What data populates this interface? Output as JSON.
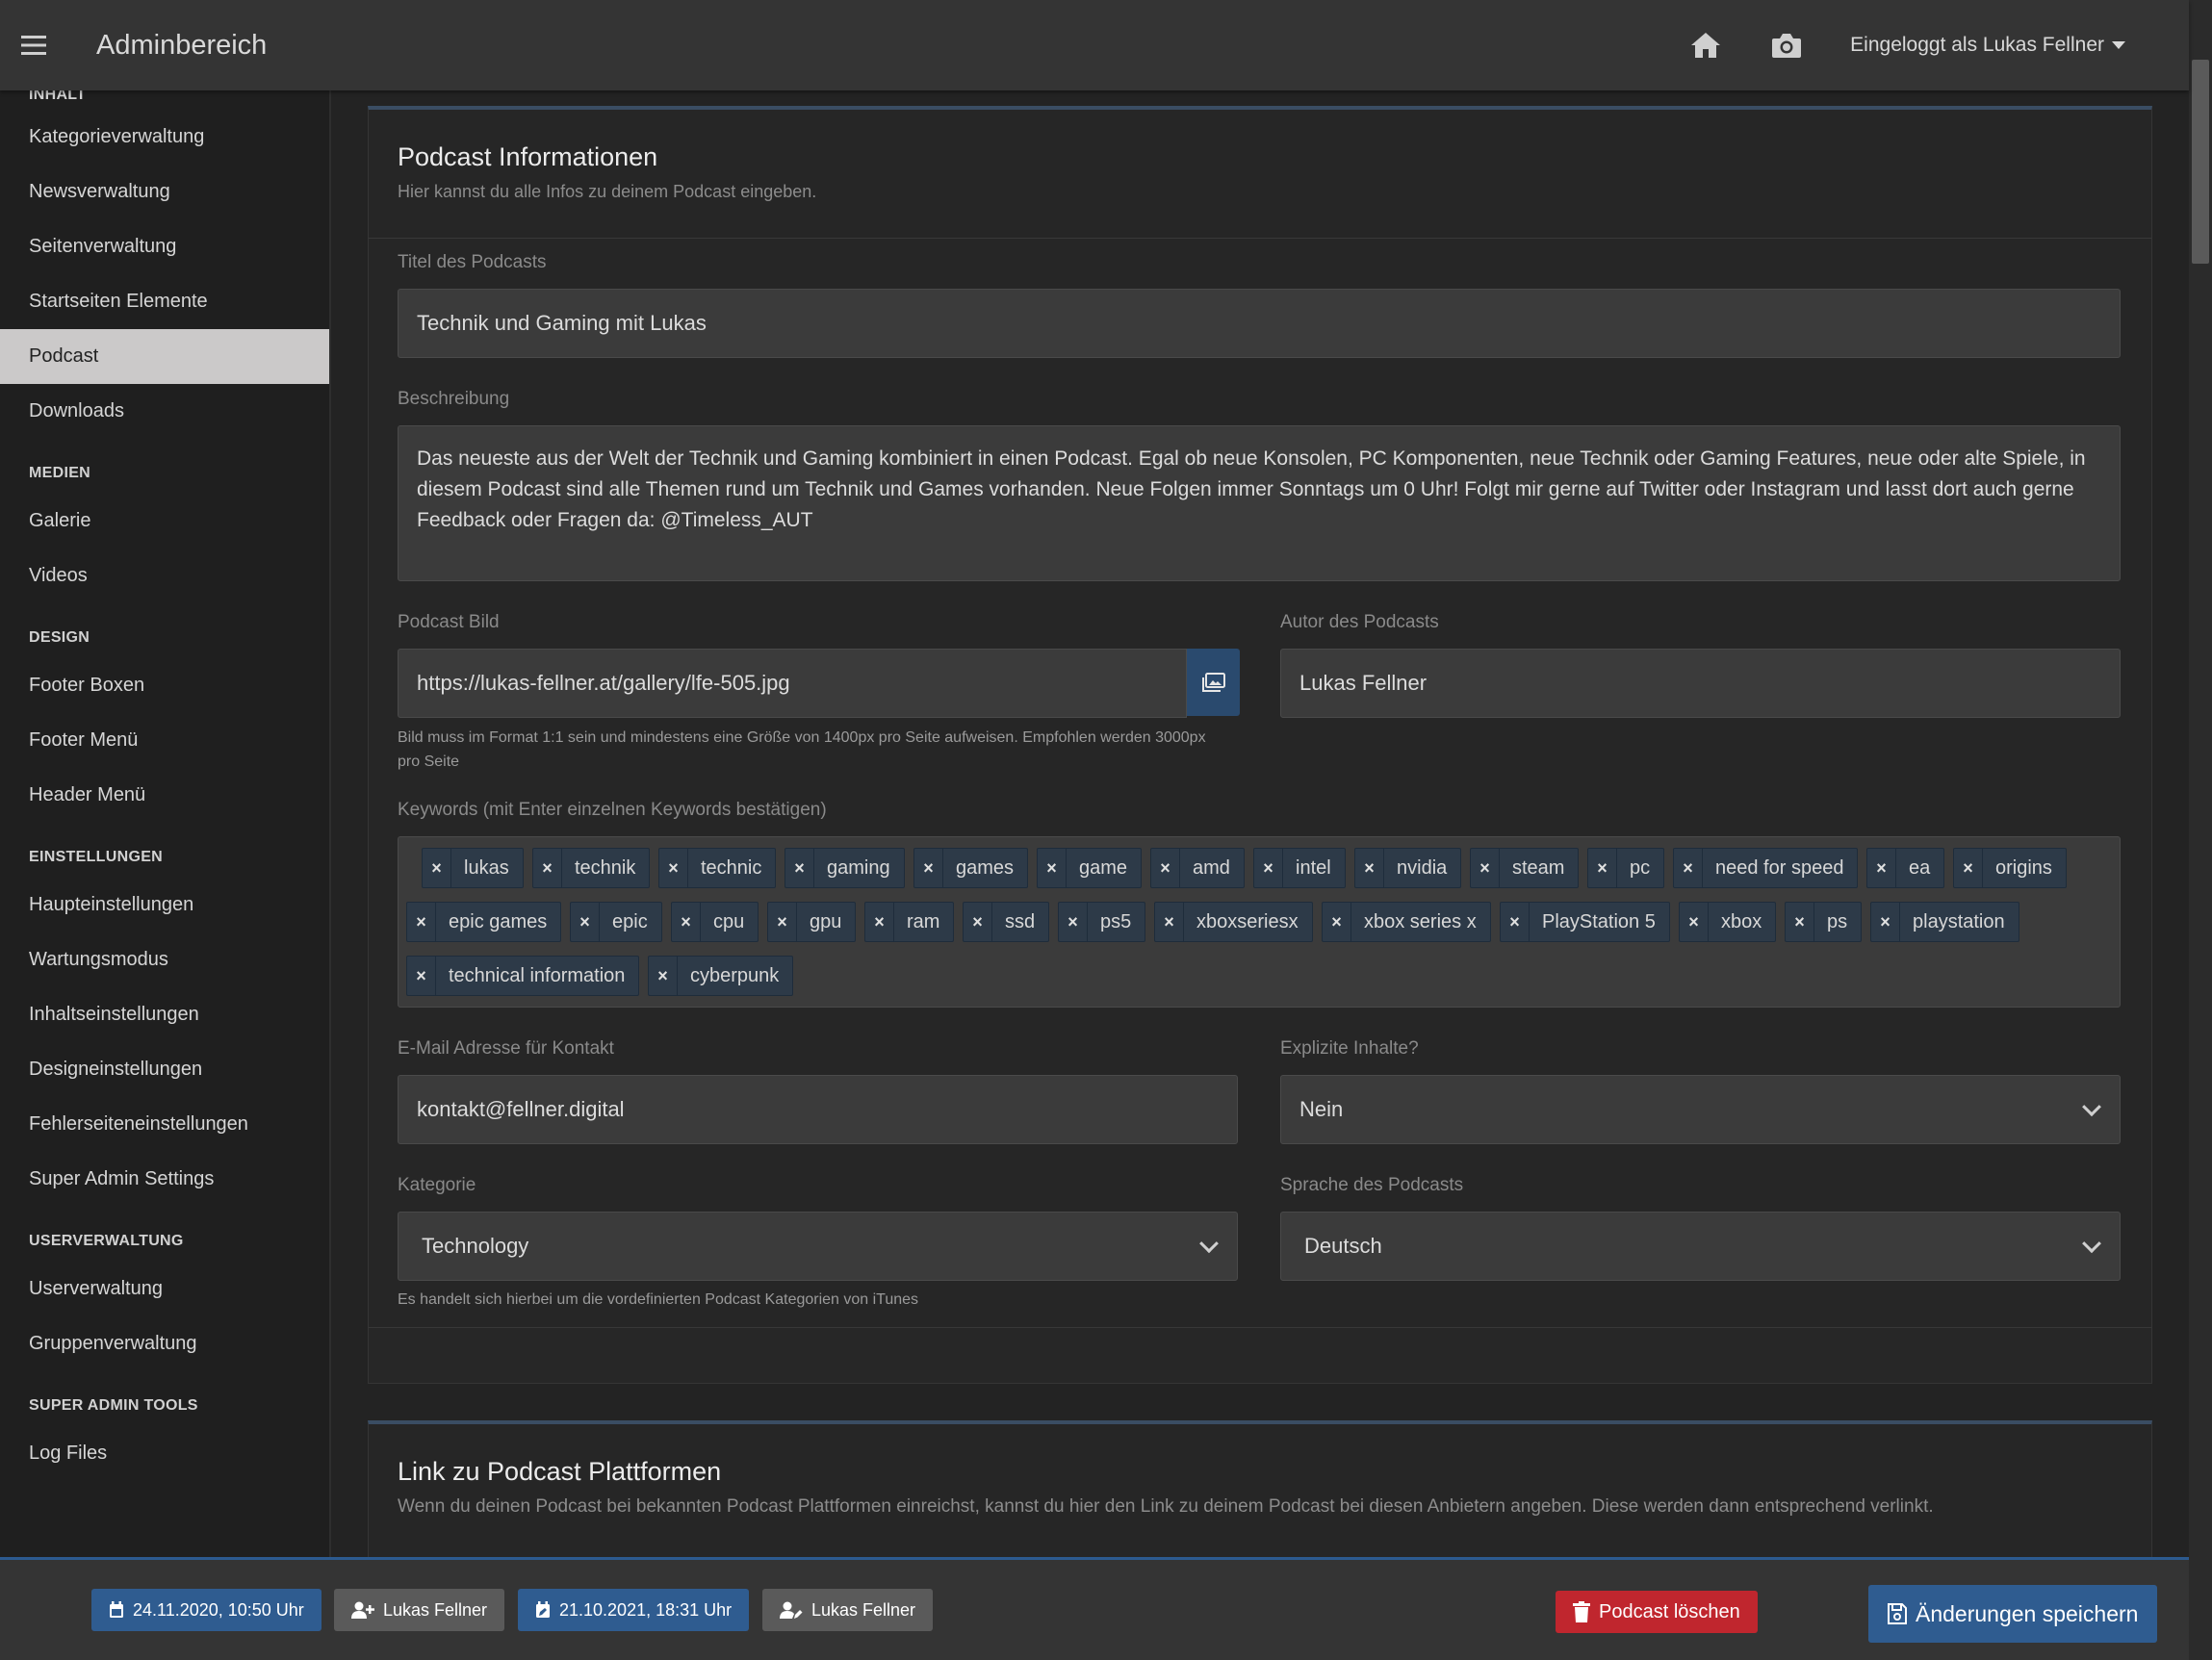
{
  "header": {
    "brand": "Adminbereich",
    "user_menu": "Eingeloggt als Lukas Fellner"
  },
  "sidebar": {
    "sections": [
      {
        "title": "INHALT",
        "items": [
          "Kategorieverwaltung",
          "Newsverwaltung",
          "Seitenverwaltung",
          "Startseiten Elemente",
          "Podcast",
          "Downloads"
        ]
      },
      {
        "title": "MEDIEN",
        "items": [
          "Galerie",
          "Videos"
        ]
      },
      {
        "title": "DESIGN",
        "items": [
          "Footer Boxen",
          "Footer Menü",
          "Header Menü"
        ]
      },
      {
        "title": "EINSTELLUNGEN",
        "items": [
          "Haupteinstellungen",
          "Wartungsmodus",
          "Inhaltseinstellungen",
          "Designeinstellungen",
          "Fehlerseiteneinstellungen",
          "Super Admin Settings"
        ]
      },
      {
        "title": "USERVERWALTUNG",
        "items": [
          "Userverwaltung",
          "Gruppenverwaltung"
        ]
      },
      {
        "title": "SUPER ADMIN TOOLS",
        "items": [
          "Log Files"
        ]
      }
    ],
    "active_item": "Podcast"
  },
  "podcast_info": {
    "title": "Podcast Informationen",
    "subtitle": "Hier kannst du alle Infos zu deinem Podcast eingeben.",
    "title_label": "Titel des Podcasts",
    "title_value": "Technik und Gaming mit Lukas",
    "description_label": "Beschreibung",
    "description_value": "Das neueste aus der Welt der Technik und Gaming kombiniert in einen Podcast. Egal ob neue Konsolen, PC Komponenten, neue Technik oder Gaming Features, neue oder alte Spiele, in diesem Podcast sind alle Themen rund um Technik und Games vorhanden. Neue Folgen immer Sonntags um 0 Uhr! Folgt mir gerne auf Twitter oder Instagram und lasst dort auch gerne Feedback oder Fragen da: @Timeless_AUT",
    "image_label": "Podcast Bild",
    "image_value": "https://lukas-fellner.at/gallery/lfe-505.jpg",
    "image_help": "Bild muss im Format 1:1 sein und mindestens eine Größe von 1400px pro Seite aufweisen. Empfohlen werden 3000px pro Seite",
    "author_label": "Autor des Podcasts",
    "author_value": "Lukas Fellner",
    "keywords_label": "Keywords (mit Enter einzelnen Keywords bestätigen)",
    "keywords": [
      "lukas",
      "technik",
      "technic",
      "gaming",
      "games",
      "game",
      "amd",
      "intel",
      "nvidia",
      "steam",
      "pc",
      "need for speed",
      "ea",
      "origins",
      "epic games",
      "epic",
      "cpu",
      "gpu",
      "ram",
      "ssd",
      "ps5",
      "xboxseriesx",
      "xbox series x",
      "PlayStation 5",
      "xbox",
      "ps",
      "playstation",
      "technical information",
      "cyberpunk"
    ],
    "email_label": "E-Mail Adresse für Kontakt",
    "email_value": "kontakt@fellner.digital",
    "explicit_label": "Explizite Inhalte?",
    "explicit_value": "Nein",
    "category_label": "Kategorie",
    "category_value": "Technology",
    "category_help": "Es handelt sich hierbei um die vordefinierten Podcast Kategorien von iTunes",
    "language_label": "Sprache des Podcasts",
    "language_value": "Deutsch"
  },
  "platforms": {
    "title": "Link zu Podcast Plattformen",
    "subtitle": "Wenn du deinen Podcast bei bekannten Podcast Plattformen einreichst, kannst du hier den Link zu deinem Podcast bei diesen Anbietern angeben. Diese werden dann entsprechend verlinkt."
  },
  "bottombar": {
    "created_date": "24.11.2020, 10:50 Uhr",
    "created_by": "Lukas Fellner",
    "modified_date": "21.10.2021, 18:31 Uhr",
    "modified_by": "Lukas Fellner",
    "delete_label": "Podcast löschen",
    "save_label": "Änderungen speichern"
  },
  "colors": {
    "accent": "#2f5c90",
    "danger": "#c0262e",
    "active_sidebar": "#cbc9c9"
  }
}
